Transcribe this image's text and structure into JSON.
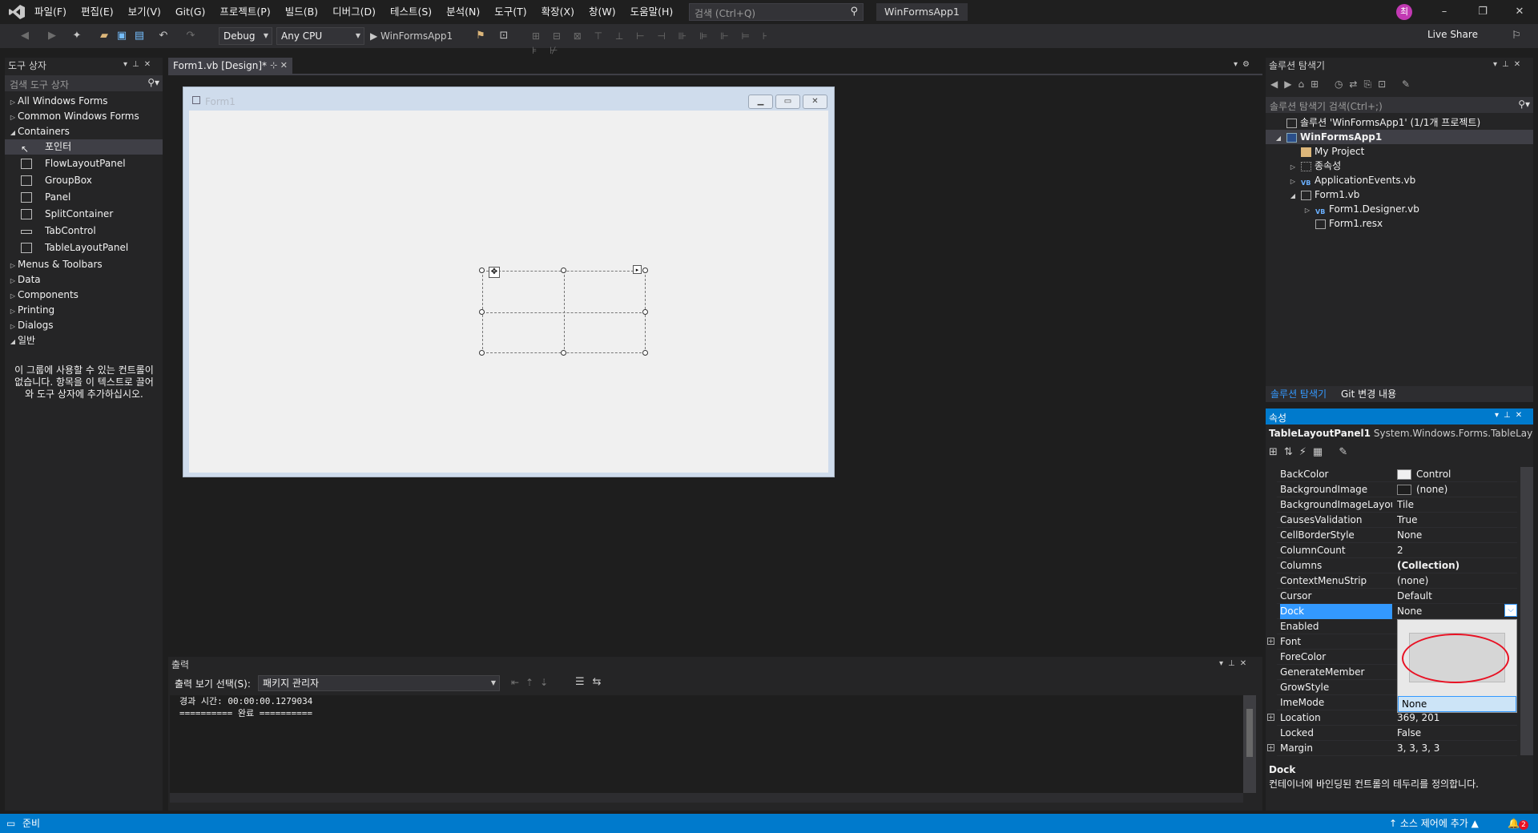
{
  "menu": [
    "파일(F)",
    "편집(E)",
    "보기(V)",
    "Git(G)",
    "프로젝트(P)",
    "빌드(B)",
    "디버그(D)",
    "테스트(S)",
    "분석(N)",
    "도구(T)",
    "확장(X)",
    "창(W)",
    "도움말(H)"
  ],
  "search": {
    "placeholder": "검색 (Ctrl+Q)"
  },
  "app_title": "WinFormsApp1",
  "avatar_initial": "최",
  "toolbar": {
    "config": "Debug",
    "platform": "Any CPU",
    "run_label": "▶ WinFormsApp1",
    "live_share": "Live Share"
  },
  "toolbox": {
    "title": "도구 상자",
    "search_placeholder": "검색 도구 상자",
    "groups": [
      "All Windows Forms",
      "Common Windows Forms",
      "Containers"
    ],
    "items": [
      "포인터",
      "FlowLayoutPanel",
      "GroupBox",
      "Panel",
      "SplitContainer",
      "TabControl",
      "TableLayoutPanel"
    ],
    "groups_after": [
      "Menus & Toolbars",
      "Data",
      "Components",
      "Printing",
      "Dialogs",
      "일반"
    ],
    "empty_text": "이 그룹에 사용할 수 있는 컨트롤이 없습니다. 항목을 이 텍스트로 끌어와 도구 상자에 추가하십시오."
  },
  "document": {
    "tab": "Form1.vb [Design]*",
    "form_title": "Form1"
  },
  "output": {
    "title": "출력",
    "source_label": "출력 보기 선택(S):",
    "source_value": "패키지 관리자",
    "lines": "경과 시간: 00:00:00.1279034\n========== 완료 =========="
  },
  "solution": {
    "title": "솔루션 탐색기",
    "search_placeholder": "솔루션 탐색기 검색(Ctrl+;)",
    "nodes": [
      "솔루션 'WinFormsApp1' (1/1개 프로젝트)",
      "WinFormsApp1",
      "My Project",
      "종속성",
      "ApplicationEvents.vb",
      "Form1.vb",
      "Form1.Designer.vb",
      "Form1.resx"
    ],
    "tabs": [
      "솔루션 탐색기",
      "Git 변경 내용"
    ]
  },
  "properties": {
    "title": "속성",
    "object_name": "TableLayoutPanel1",
    "object_type": "System.Windows.Forms.TableLayoutF",
    "rows": [
      {
        "name": "BackColor",
        "value": "Control"
      },
      {
        "name": "BackgroundImage",
        "value": "(none)"
      },
      {
        "name": "BackgroundImageLayout",
        "value": "Tile"
      },
      {
        "name": "CausesValidation",
        "value": "True"
      },
      {
        "name": "CellBorderStyle",
        "value": "None"
      },
      {
        "name": "ColumnCount",
        "value": "2"
      },
      {
        "name": "Columns",
        "value": "(Collection)"
      },
      {
        "name": "ContextMenuStrip",
        "value": "(none)"
      },
      {
        "name": "Cursor",
        "value": "Default"
      },
      {
        "name": "Dock",
        "value": "None"
      },
      {
        "name": "Enabled",
        "value": ""
      },
      {
        "name": "Font",
        "value": ""
      },
      {
        "name": "ForeColor",
        "value": ""
      },
      {
        "name": "GenerateMember",
        "value": ""
      },
      {
        "name": "GrowStyle",
        "value": ""
      },
      {
        "name": "ImeMode",
        "value": ""
      },
      {
        "name": "Location",
        "value": "369, 201"
      },
      {
        "name": "Locked",
        "value": "False"
      },
      {
        "name": "Margin",
        "value": "3, 3, 3, 3"
      }
    ],
    "dock_option": "None",
    "desc_title": "Dock",
    "desc_text": "컨테이너에 바인딩된 컨트롤의 테두리를 정의합니다."
  },
  "status": {
    "ready": "준비",
    "source_control": "↑ 소스 제어에 추가 ▲",
    "notifications": "2"
  },
  "colors": {
    "accent": "#007acc",
    "selection": "#3399ff",
    "annotation": "#e81123"
  }
}
